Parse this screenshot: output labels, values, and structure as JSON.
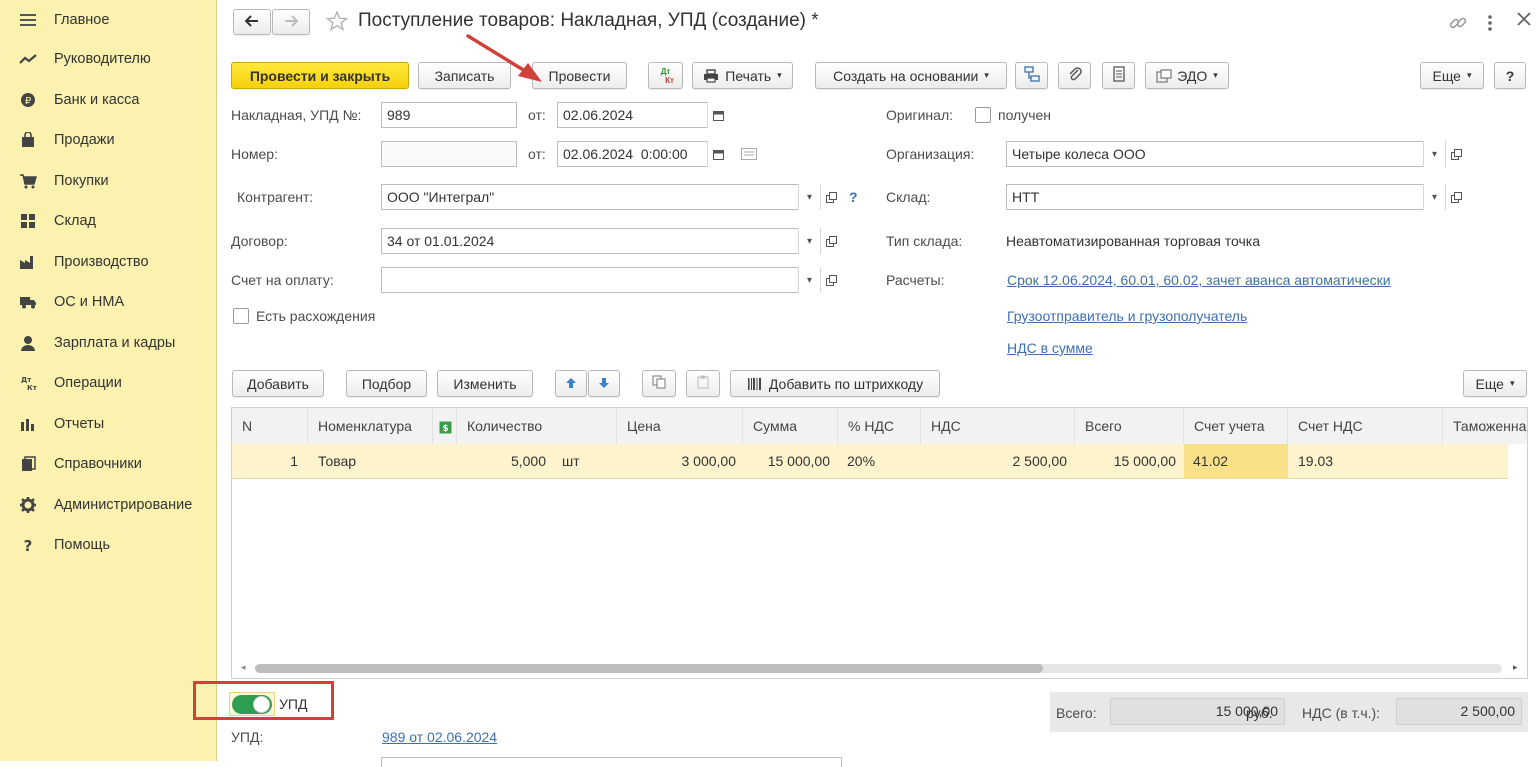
{
  "sidebar": {
    "items": [
      {
        "label": "Главное",
        "icon": "menu-icon"
      },
      {
        "label": "Руководителю",
        "icon": "trend-icon"
      },
      {
        "label": "Банк и касса",
        "icon": "coin-icon"
      },
      {
        "label": "Продажи",
        "icon": "bag-icon"
      },
      {
        "label": "Покупки",
        "icon": "cart-icon"
      },
      {
        "label": "Склад",
        "icon": "warehouse-icon"
      },
      {
        "label": "Производство",
        "icon": "factory-icon"
      },
      {
        "label": "ОС и НМА",
        "icon": "truck-icon"
      },
      {
        "label": "Зарплата и кадры",
        "icon": "person-icon"
      },
      {
        "label": "Операции",
        "icon": "dt-kt-icon"
      },
      {
        "label": "Отчеты",
        "icon": "bar-chart-icon"
      },
      {
        "label": "Справочники",
        "icon": "book-icon"
      },
      {
        "label": "Администрирование",
        "icon": "gear-icon"
      },
      {
        "label": "Помощь",
        "icon": "question-icon"
      }
    ]
  },
  "header": {
    "title": "Поступление товаров: Накладная, УПД (создание) *"
  },
  "toolbar": {
    "post_close": "Провести и закрыть",
    "save": "Записать",
    "post": "Провести",
    "dt_kt_top": "Дт",
    "dt_kt_bottom": "Кт",
    "print": "Печать",
    "create_based": "Создать на основании",
    "edo": "ЭДО",
    "more": "Еще",
    "help": "?"
  },
  "form": {
    "invoice_label": "Накладная, УПД №:",
    "invoice_number": "989",
    "from_label": "от:",
    "invoice_date": "02.06.2024",
    "number_label": "Номер:",
    "number_value": "",
    "from_label2": "от:",
    "number_date": "02.06.2024  0:00:00",
    "counterparty_label": "Контрагент:",
    "counterparty": "ООО \"Интеграл\"",
    "question": "?",
    "contract_label": "Договор:",
    "contract": "34 от 01.01.2024",
    "payment_account_label": "Счет на оплату:",
    "payment_account": "",
    "discrepancy_label": "Есть расхождения",
    "original_label": "Оригинал:",
    "original_received": "получен",
    "organization_label": "Организация:",
    "organization": "Четыре колеса ООО",
    "warehouse_label": "Склад:",
    "warehouse": "НТТ",
    "warehouse_type_label": "Тип склада:",
    "warehouse_type": "Неавтоматизированная торговая точка",
    "settlements_label": "Расчеты:",
    "settlements_link": "Срок 12.06.2024, 60.01, 60.02, зачет аванса автоматически",
    "shipper_link": "Грузоотправитель и грузополучатель",
    "vat_link": "НДС в сумме"
  },
  "table_toolbar": {
    "add": "Добавить",
    "pick": "Подбор",
    "edit": "Изменить",
    "barcode": "Добавить по штрихкоду",
    "more": "Еще"
  },
  "table": {
    "columns": [
      "N",
      "Номенклатура",
      "Количество",
      "Цена",
      "Сумма",
      "% НДС",
      "НДС",
      "Всего",
      "Счет учета",
      "Счет НДС",
      "Таможенна"
    ],
    "rows": [
      {
        "n": "1",
        "item": "Товар",
        "qty": "5,000",
        "unit": "шт",
        "price": "3 000,00",
        "sum": "15 000,00",
        "vat_rate": "20%",
        "vat": "2 500,00",
        "total": "15 000,00",
        "account": "41.02",
        "vat_account": "19.03"
      }
    ]
  },
  "footer": {
    "upd_toggle_label": "УПД",
    "upd_label": "УПД:",
    "upd_link": "989 от 02.06.2024",
    "total_label": "Всего:",
    "total_value": "15 000,00",
    "currency": "руб.",
    "vat_incl_label": "НДС (в т.ч.):",
    "vat_incl_value": "2 500,00"
  },
  "colors": {
    "sidebar_bg": "#fbf2b0",
    "primary_button": "#f5d10d",
    "annotation_red": "#d0413a",
    "toggle_green": "#2e9e52",
    "link": "#3d6fb5",
    "row_highlight": "#fdf3cc"
  }
}
